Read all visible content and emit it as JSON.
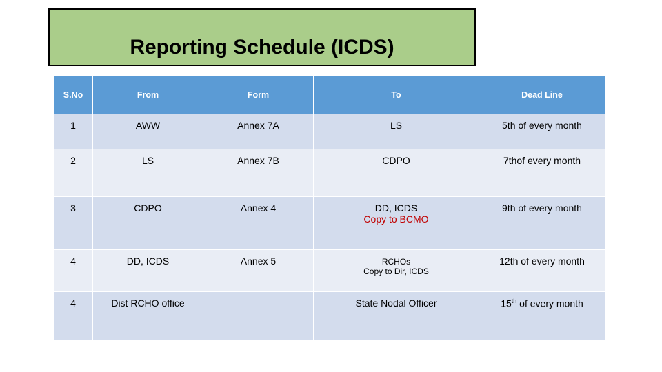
{
  "slide": {
    "title": "Reporting Schedule (ICDS)",
    "banner_color": "#aacd8a",
    "banner_border_color": "#000000",
    "background": "#ffffff"
  },
  "table": {
    "header_bg": "#5b9bd5",
    "header_text_color": "#ffffff",
    "row_band_a": "#d3dced",
    "row_band_b": "#e9edf5",
    "accent_red": "#c00000",
    "headers": [
      "S.No",
      "From",
      "Form",
      "To",
      "Dead Line"
    ],
    "rows": [
      {
        "sno": "1",
        "from": "AWW",
        "form": "Annex 7A",
        "to": "LS",
        "to_sub": "",
        "deadline": "5th of every month",
        "deadline_suffix": ""
      },
      {
        "sno": "2",
        "from": "LS",
        "form": "Annex 7B",
        "to": "CDPO",
        "to_sub": "",
        "deadline": "7thof every month",
        "deadline_suffix": ""
      },
      {
        "sno": "3",
        "from": "CDPO",
        "form": "Annex 4",
        "to": "DD, ICDS",
        "to_sub": "Copy to BCMO",
        "deadline": "9th of every month",
        "deadline_suffix": ""
      },
      {
        "sno": "4",
        "from": "DD, ICDS",
        "form": "Annex 5",
        "to": "RCHOs",
        "to_sub": "Copy to Dir,  ICDS",
        "deadline": "12th of every month",
        "deadline_suffix": ""
      },
      {
        "sno": "4",
        "from": "Dist RCHO office",
        "form": "",
        "to": "State Nodal Officer",
        "to_sub": "",
        "deadline": "15",
        "deadline_suffix": "th",
        "deadline_rest": " of every month"
      }
    ]
  }
}
